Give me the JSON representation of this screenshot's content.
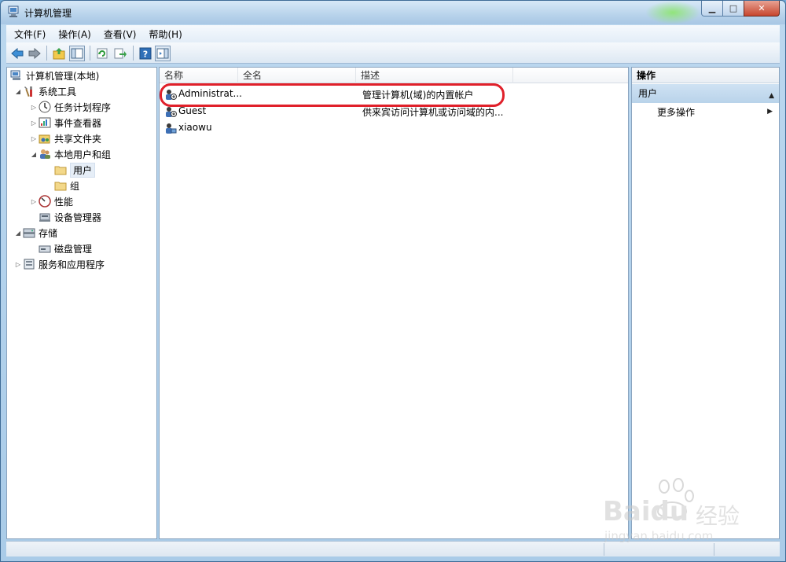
{
  "window": {
    "title": "计算机管理"
  },
  "menu": [
    "文件(F)",
    "操作(A)",
    "查看(V)",
    "帮助(H)"
  ],
  "toolbar": {
    "icons": [
      "back-arrow-icon",
      "forward-arrow-icon",
      "up-folder-icon",
      "show-hide-tree-icon",
      "refresh-icon",
      "export-list-icon",
      "help-icon",
      "show-hide-action-pane-icon"
    ]
  },
  "tree": {
    "root": "计算机管理(本地)",
    "system_tools": "系统工具",
    "task_scheduler": "任务计划程序",
    "event_viewer": "事件查看器",
    "shared_folders": "共享文件夹",
    "local_users_groups": "本地用户和组",
    "users": "用户",
    "groups": "组",
    "performance": "性能",
    "device_manager": "设备管理器",
    "storage": "存储",
    "disk_management": "磁盘管理",
    "services_apps": "服务和应用程序"
  },
  "list": {
    "columns": [
      "名称",
      "全名",
      "描述"
    ],
    "rows": [
      {
        "name": "Administrat...",
        "fullname": "",
        "description": "管理计算机(域)的内置帐户"
      },
      {
        "name": "Guest",
        "fullname": "",
        "description": "供来宾访问计算机或访问域的内..."
      },
      {
        "name": "xiaowu",
        "fullname": "",
        "description": ""
      }
    ]
  },
  "actions": {
    "title": "操作",
    "section": "用户",
    "more": "更多操作"
  },
  "watermark": {
    "brand": "Baidu",
    "brand_cn": "经验",
    "url": "jingyan.baidu.com"
  },
  "colors": {
    "highlight_ring": "#e0202a",
    "title_glow": "#8ce66e",
    "action_header": "#b9d3ea"
  }
}
